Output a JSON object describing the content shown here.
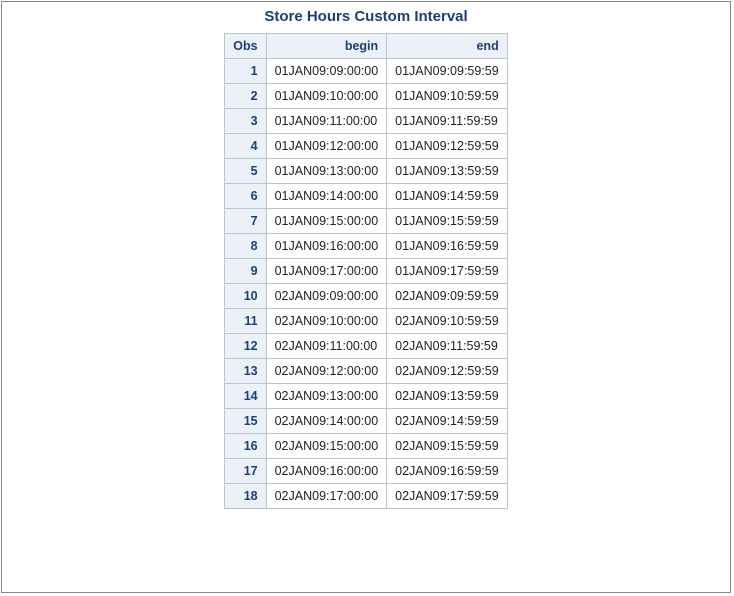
{
  "title": "Store Hours Custom Interval",
  "headers": {
    "obs": "Obs",
    "begin": "begin",
    "end": "end"
  },
  "rows": [
    {
      "obs": "1",
      "begin": "01JAN09:09:00:00",
      "end": "01JAN09:09:59:59"
    },
    {
      "obs": "2",
      "begin": "01JAN09:10:00:00",
      "end": "01JAN09:10:59:59"
    },
    {
      "obs": "3",
      "begin": "01JAN09:11:00:00",
      "end": "01JAN09:11:59:59"
    },
    {
      "obs": "4",
      "begin": "01JAN09:12:00:00",
      "end": "01JAN09:12:59:59"
    },
    {
      "obs": "5",
      "begin": "01JAN09:13:00:00",
      "end": "01JAN09:13:59:59"
    },
    {
      "obs": "6",
      "begin": "01JAN09:14:00:00",
      "end": "01JAN09:14:59:59"
    },
    {
      "obs": "7",
      "begin": "01JAN09:15:00:00",
      "end": "01JAN09:15:59:59"
    },
    {
      "obs": "8",
      "begin": "01JAN09:16:00:00",
      "end": "01JAN09:16:59:59"
    },
    {
      "obs": "9",
      "begin": "01JAN09:17:00:00",
      "end": "01JAN09:17:59:59"
    },
    {
      "obs": "10",
      "begin": "02JAN09:09:00:00",
      "end": "02JAN09:09:59:59"
    },
    {
      "obs": "11",
      "begin": "02JAN09:10:00:00",
      "end": "02JAN09:10:59:59"
    },
    {
      "obs": "12",
      "begin": "02JAN09:11:00:00",
      "end": "02JAN09:11:59:59"
    },
    {
      "obs": "13",
      "begin": "02JAN09:12:00:00",
      "end": "02JAN09:12:59:59"
    },
    {
      "obs": "14",
      "begin": "02JAN09:13:00:00",
      "end": "02JAN09:13:59:59"
    },
    {
      "obs": "15",
      "begin": "02JAN09:14:00:00",
      "end": "02JAN09:14:59:59"
    },
    {
      "obs": "16",
      "begin": "02JAN09:15:00:00",
      "end": "02JAN09:15:59:59"
    },
    {
      "obs": "17",
      "begin": "02JAN09:16:00:00",
      "end": "02JAN09:16:59:59"
    },
    {
      "obs": "18",
      "begin": "02JAN09:17:00:00",
      "end": "02JAN09:17:59:59"
    }
  ]
}
